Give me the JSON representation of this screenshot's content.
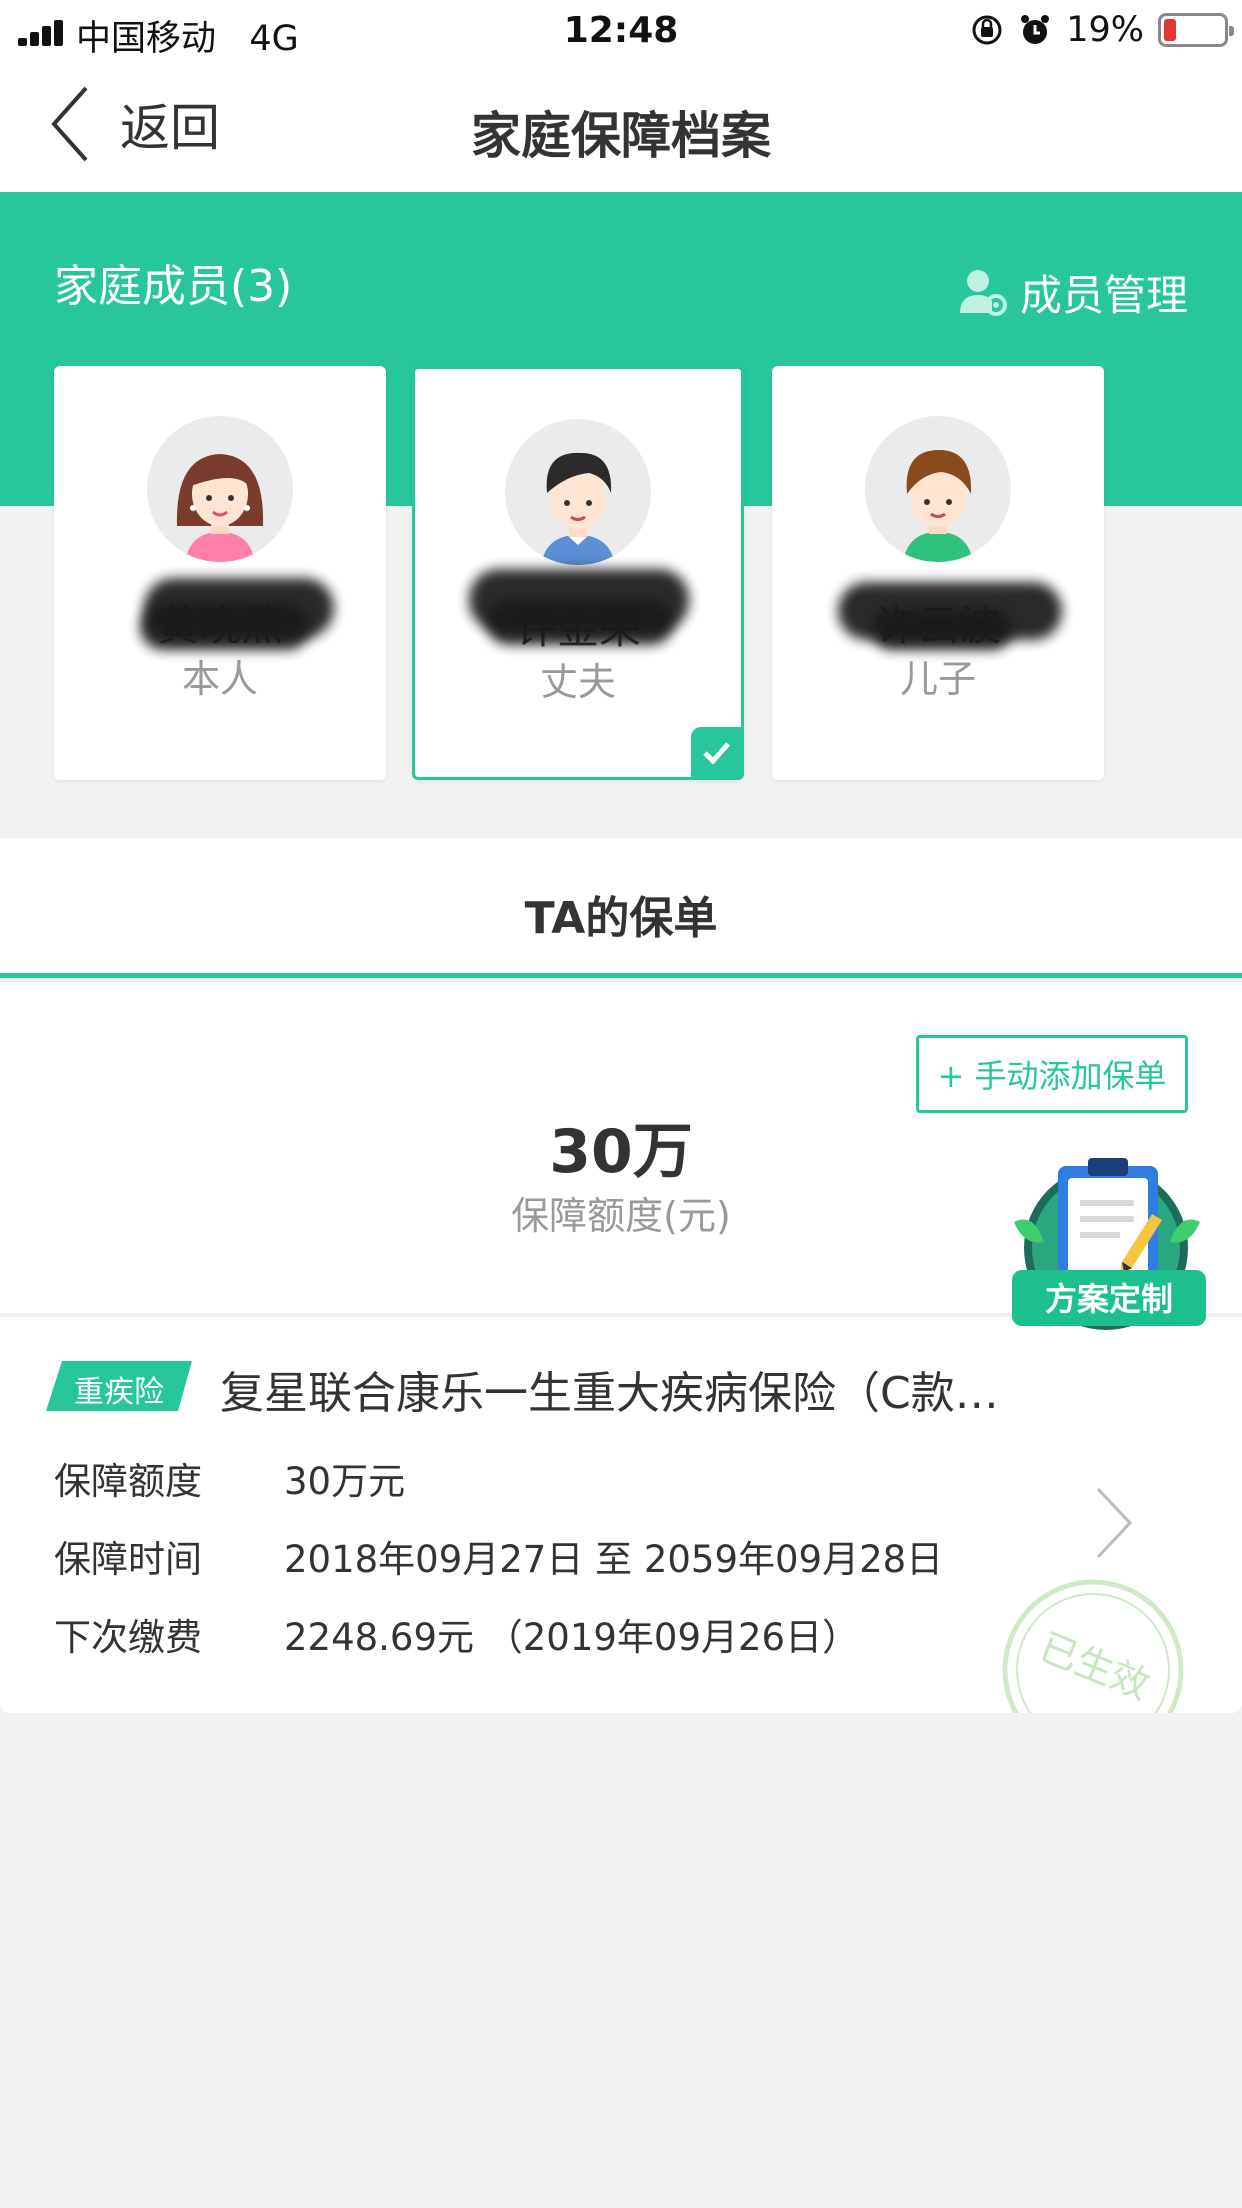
{
  "status_bar": {
    "carrier": "中国移动",
    "network": "4G",
    "time": "12:48",
    "battery_percent": "19%"
  },
  "nav": {
    "back_label": "返回",
    "title": "家庭保障档案"
  },
  "family": {
    "title": "家庭成员(3)",
    "manage_label": "成员管理",
    "members": [
      {
        "name": "黄晓燕",
        "relation": "本人",
        "avatar": "woman-avatar",
        "selected": false
      },
      {
        "name": "许金荣",
        "relation": "丈夫",
        "avatar": "man-avatar",
        "selected": true
      },
      {
        "name": "许云波",
        "relation": "儿子",
        "avatar": "boy-avatar",
        "selected": false
      }
    ]
  },
  "policies_tab": {
    "title": "TA的保单"
  },
  "summary": {
    "add_button": "+ 手动添加保单",
    "amount": "30万",
    "amount_label": "保障额度(元)"
  },
  "fab": {
    "label": "方案定制",
    "icon": "clipboard-pencil-icon"
  },
  "policy": {
    "tag": "重疾险",
    "name": "复星联合康乐一生重大疾病保险（C款…",
    "rows": [
      {
        "label": "保障额度",
        "value": "30万元"
      },
      {
        "label": "保障时间",
        "value": "2018年09月27日 至 2059年09月28日"
      },
      {
        "label": "下次缴费",
        "value": "2248.69元 （2019年09月26日）"
      }
    ],
    "stamp": "已生效"
  },
  "colors": {
    "accent": "#27c69c",
    "background": "#f2f2f2"
  }
}
